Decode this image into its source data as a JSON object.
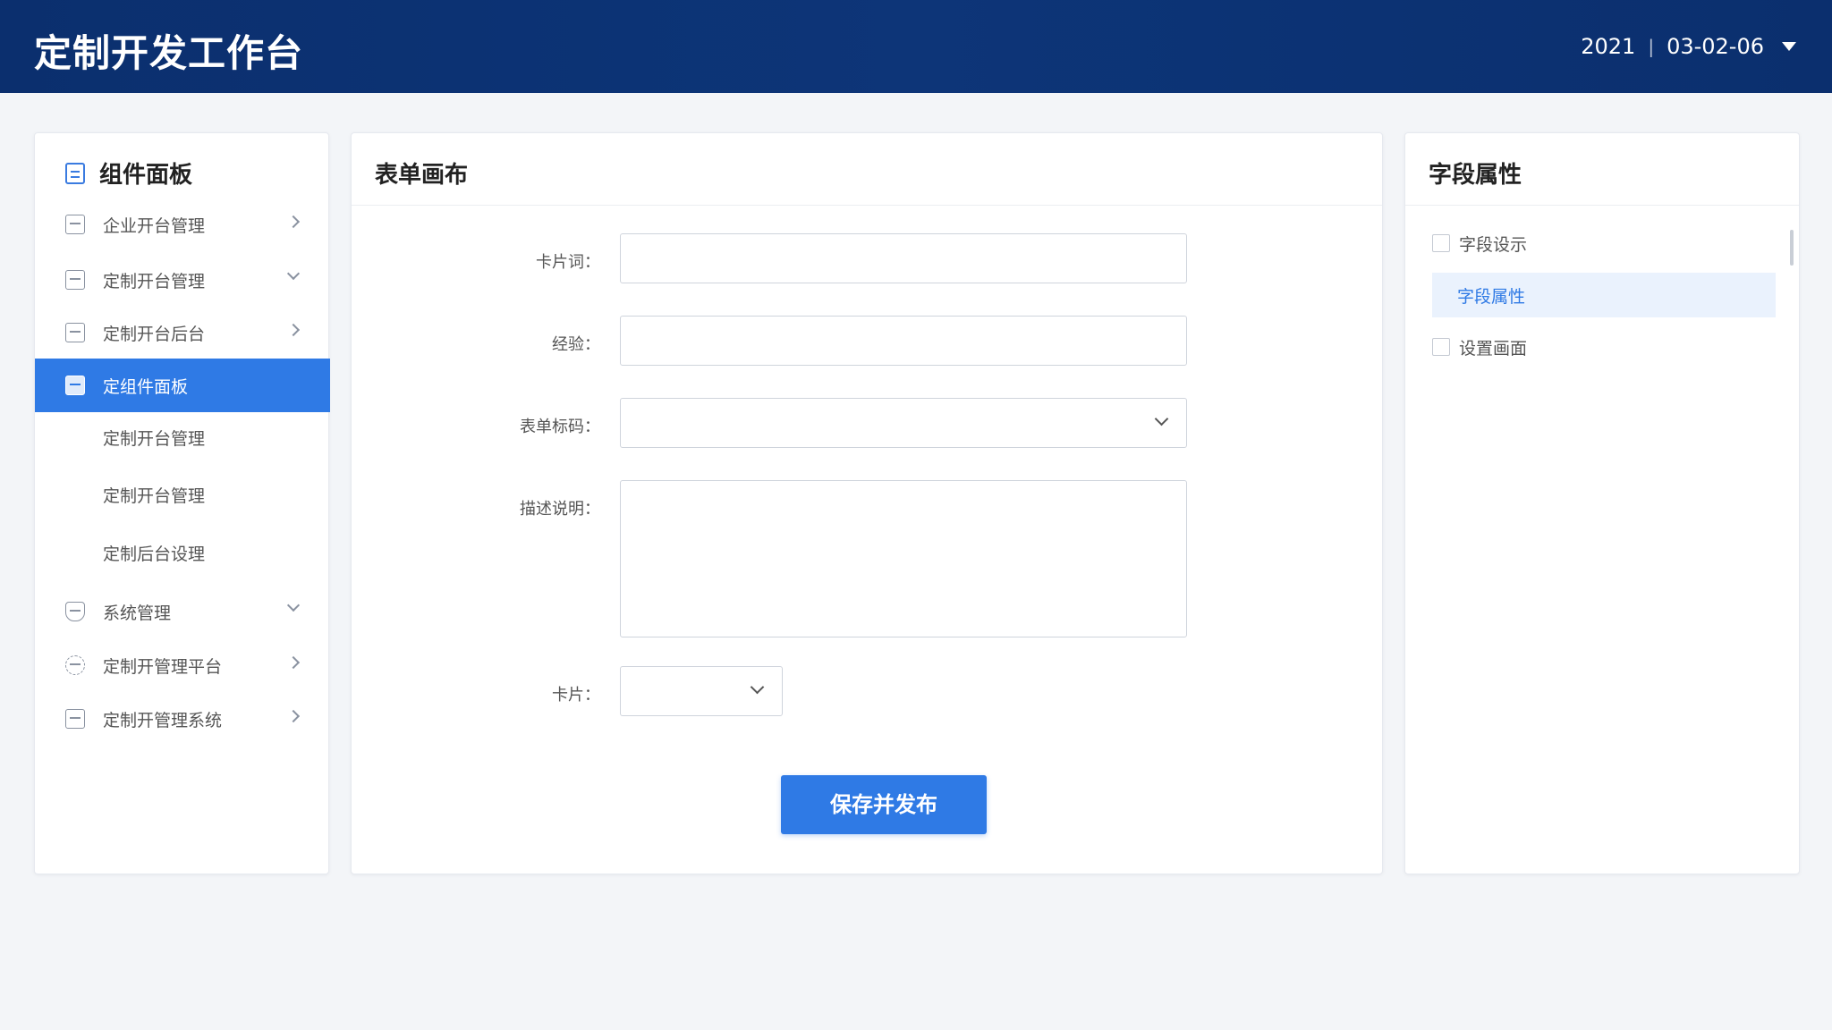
{
  "header": {
    "title": "定制开发工作台",
    "year": "2021",
    "date": "03-02-06"
  },
  "left": {
    "title": "组件面板",
    "items": [
      {
        "label": "企业开台管理",
        "icon": "panel-icon",
        "chevron": "right"
      },
      {
        "label": "定制开台管理",
        "icon": "document-icon",
        "chevron": "down"
      },
      {
        "label": "定制开台后台",
        "icon": "clipboard-icon",
        "chevron": "right"
      },
      {
        "label": "定组件面板",
        "icon": "form-icon",
        "active": true
      },
      {
        "label": "系统管理",
        "icon": "shield-icon",
        "chevron": "down"
      },
      {
        "label": "定制开管理平台",
        "icon": "gear-icon",
        "chevron": "right"
      },
      {
        "label": "定制开管理系统",
        "icon": "calendar-icon",
        "chevron": "right"
      }
    ],
    "subitems": [
      "定制开台管理",
      "定制开台管理",
      "定制后台设理"
    ]
  },
  "center": {
    "title": "表单画布",
    "fields": [
      {
        "label": "卡片词：",
        "value": ""
      },
      {
        "label": "经验：",
        "value": ""
      },
      {
        "label": "表单标码：",
        "value": ""
      },
      {
        "label": "描述说明：",
        "value": ""
      },
      {
        "label": "卡片：",
        "value": ""
      }
    ],
    "submit": "保存并发布"
  },
  "right": {
    "title": "字段属性",
    "items": [
      {
        "label": "字段设示",
        "checkbox": true
      },
      {
        "label": "字段属性",
        "selected": true
      },
      {
        "label": "设置画面",
        "checkbox": true
      }
    ]
  },
  "colors": {
    "header": "#0b2f6e",
    "accent": "#2f7ae5"
  }
}
